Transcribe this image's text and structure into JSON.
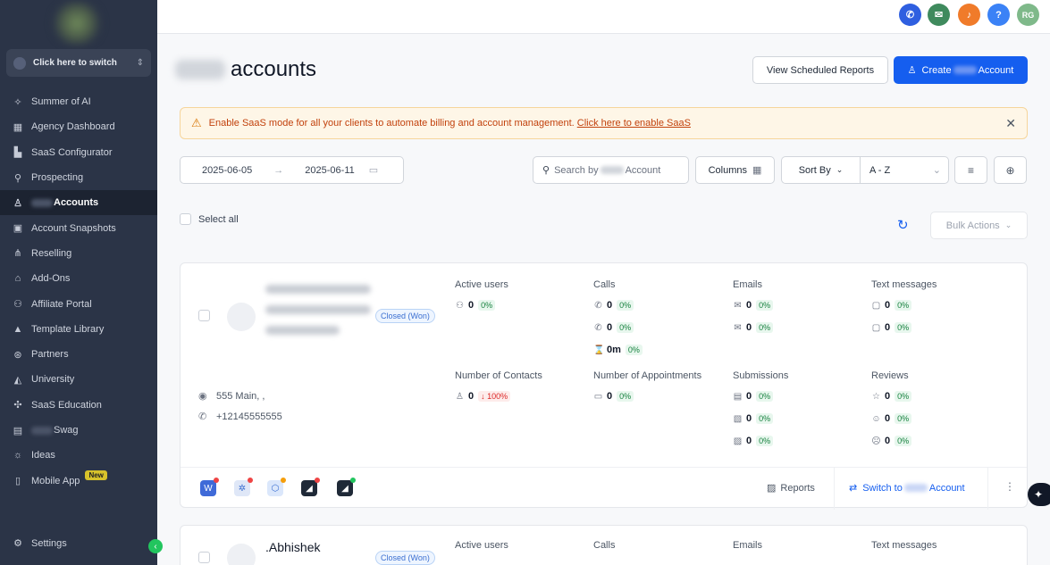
{
  "sidebar": {
    "switcher_label": "Click here to switch",
    "items": [
      {
        "label": "Summer of AI",
        "icon": "sparkle-icon"
      },
      {
        "label": "Agency Dashboard",
        "icon": "dashboard-icon"
      },
      {
        "label": "SaaS Configurator",
        "icon": "chart-icon"
      },
      {
        "label": "Prospecting",
        "icon": "user-search-icon"
      },
      {
        "label": "Accounts",
        "icon": "user-icon"
      },
      {
        "label": "Account Snapshots",
        "icon": "image-icon"
      },
      {
        "label": "Reselling",
        "icon": "tree-icon"
      },
      {
        "label": "Add-Ons",
        "icon": "bag-icon"
      },
      {
        "label": "Affiliate Portal",
        "icon": "people-icon"
      },
      {
        "label": "Template Library",
        "icon": "shapes-icon"
      },
      {
        "label": "Partners",
        "icon": "handshake-icon"
      },
      {
        "label": "University",
        "icon": "graduation-icon"
      },
      {
        "label": "SaaS Education",
        "icon": "puzzle-icon"
      },
      {
        "label": "Swag",
        "icon": "store-icon"
      },
      {
        "label": "Ideas",
        "icon": "bulb-icon"
      },
      {
        "label": "Mobile App",
        "icon": "phone-icon",
        "badge": "New"
      }
    ],
    "settings_label": "Settings"
  },
  "topbar": {
    "avatar_initials": "RG",
    "help_label": "?"
  },
  "header": {
    "title": "accounts",
    "scheduled_reports_label": "View Scheduled Reports",
    "create_prefix": "Create",
    "create_suffix": "Account"
  },
  "alert": {
    "message": "Enable SaaS mode for all your clients to automate billing and account management.",
    "link": "Click here to enable SaaS"
  },
  "filters": {
    "date_start": "2025-06-05",
    "date_end": "2025-06-11",
    "search_prefix": "Search by",
    "search_suffix": "Account",
    "columns_label": "Columns",
    "sort_by_label": "Sort By",
    "sort_value": "A - Z",
    "select_all_label": "Select all",
    "bulk_actions_label": "Bulk Actions"
  },
  "accounts": [
    {
      "status": "Closed (Won)",
      "address": "555 Main, ,",
      "phone": "+12145555555",
      "metrics": {
        "active_users": {
          "label": "Active users",
          "value": "0",
          "pct": "0%"
        },
        "calls": {
          "label": "Calls",
          "rows": [
            {
              "value": "0",
              "pct": "0%"
            },
            {
              "value": "0",
              "pct": "0%"
            },
            {
              "value": "0m",
              "pct": "0%"
            }
          ]
        },
        "emails": {
          "label": "Emails",
          "rows": [
            {
              "value": "0",
              "pct": "0%"
            },
            {
              "value": "0",
              "pct": "0%"
            }
          ]
        },
        "texts": {
          "label": "Text messages",
          "rows": [
            {
              "value": "0",
              "pct": "0%"
            },
            {
              "value": "0",
              "pct": "0%"
            }
          ]
        },
        "contacts": {
          "label": "Number of Contacts",
          "value": "0",
          "pct": "100%"
        },
        "appointments": {
          "label": "Number of Appointments",
          "value": "0",
          "pct": "0%"
        },
        "submissions": {
          "label": "Submissions",
          "rows": [
            {
              "value": "0",
              "pct": "0%"
            },
            {
              "value": "0",
              "pct": "0%"
            },
            {
              "value": "0",
              "pct": "0%"
            }
          ]
        },
        "reviews": {
          "label": "Reviews",
          "rows": [
            {
              "value": "0",
              "pct": "0%"
            },
            {
              "value": "0",
              "pct": "0%"
            },
            {
              "value": "0",
              "pct": "0%"
            }
          ]
        }
      },
      "reports_label": "Reports",
      "switch_prefix": "Switch to",
      "switch_suffix": "Account"
    },
    {
      "name": ".Abhishek",
      "status": "Closed (Won)",
      "metric_labels": {
        "active_users": "Active users",
        "calls": "Calls",
        "emails": "Emails",
        "texts": "Text messages"
      }
    }
  ],
  "colors": {
    "primary": "#155eef",
    "sidebar": "#2b3447",
    "alert_bg": "#fef6e7",
    "alert_text": "#c2410c"
  }
}
